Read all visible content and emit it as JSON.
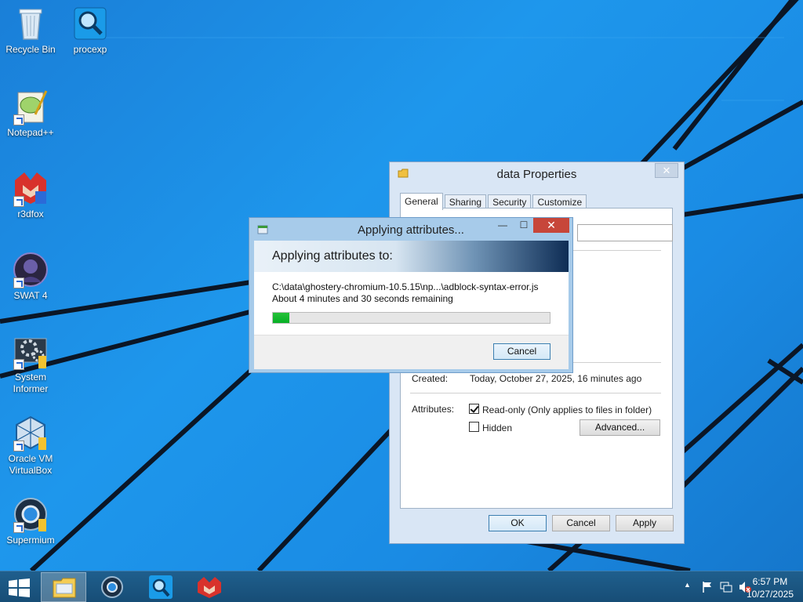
{
  "desktop": {
    "icons": [
      {
        "label": "Recycle Bin",
        "icon": "recycle-bin-icon"
      },
      {
        "label": "procexp",
        "icon": "procexp-icon"
      },
      {
        "label": "Notepad++",
        "icon": "notepad-plus-plus-icon"
      },
      {
        "label": "r3dfox",
        "icon": "r3dfox-icon"
      },
      {
        "label": "SWAT 4",
        "icon": "swat4-icon"
      },
      {
        "label": "System Informer",
        "icon": "system-informer-icon"
      },
      {
        "label": "Oracle VM VirtualBox",
        "icon": "virtualbox-icon"
      },
      {
        "label": "Supermium",
        "icon": "supermium-icon"
      }
    ]
  },
  "properties_dialog": {
    "title": "data Properties",
    "close_glyph": "✕",
    "tabs": [
      "General",
      "Sharing",
      "Security",
      "Customize"
    ],
    "active_tab": "General",
    "created_label": "Created:",
    "created_value": "Today, October 27, 2025, 16 minutes ago",
    "attributes_label": "Attributes:",
    "readonly_label": "Read-only (Only applies to files in folder)",
    "readonly_checked": true,
    "hidden_label": "Hidden",
    "hidden_checked": false,
    "advanced_button": "Advanced...",
    "ok_button": "OK",
    "cancel_button": "Cancel",
    "apply_button": "Apply"
  },
  "apply_dialog": {
    "title": "Applying attributes...",
    "min_glyph": "—",
    "max_glyph": "☐",
    "close_glyph": "✕",
    "heading": "Applying attributes to:",
    "path": "C:\\data\\ghostery-chromium-10.5.15\\np...\\adblock-syntax-error.js",
    "remaining": "About 4 minutes and 30 seconds remaining",
    "progress_fraction": 0.06,
    "cancel_button": "Cancel"
  },
  "taskbar": {
    "start_icon": "windows-start-icon",
    "pinned": [
      "file-explorer-icon",
      "supermium-icon",
      "procexp-icon",
      "r3dfox-icon"
    ],
    "tray": {
      "chevron": "▲",
      "icons": [
        "action-center-flag-icon",
        "network-icon",
        "volume-muted-icon"
      ]
    },
    "clock_time": "6:57 PM",
    "clock_date": "10/27/2025"
  },
  "colors": {
    "desktop_bg": "#1a8ee6",
    "progress_fill": "#06b025",
    "close_red": "#c7463a",
    "taskbar_bg": "#1a5582"
  }
}
